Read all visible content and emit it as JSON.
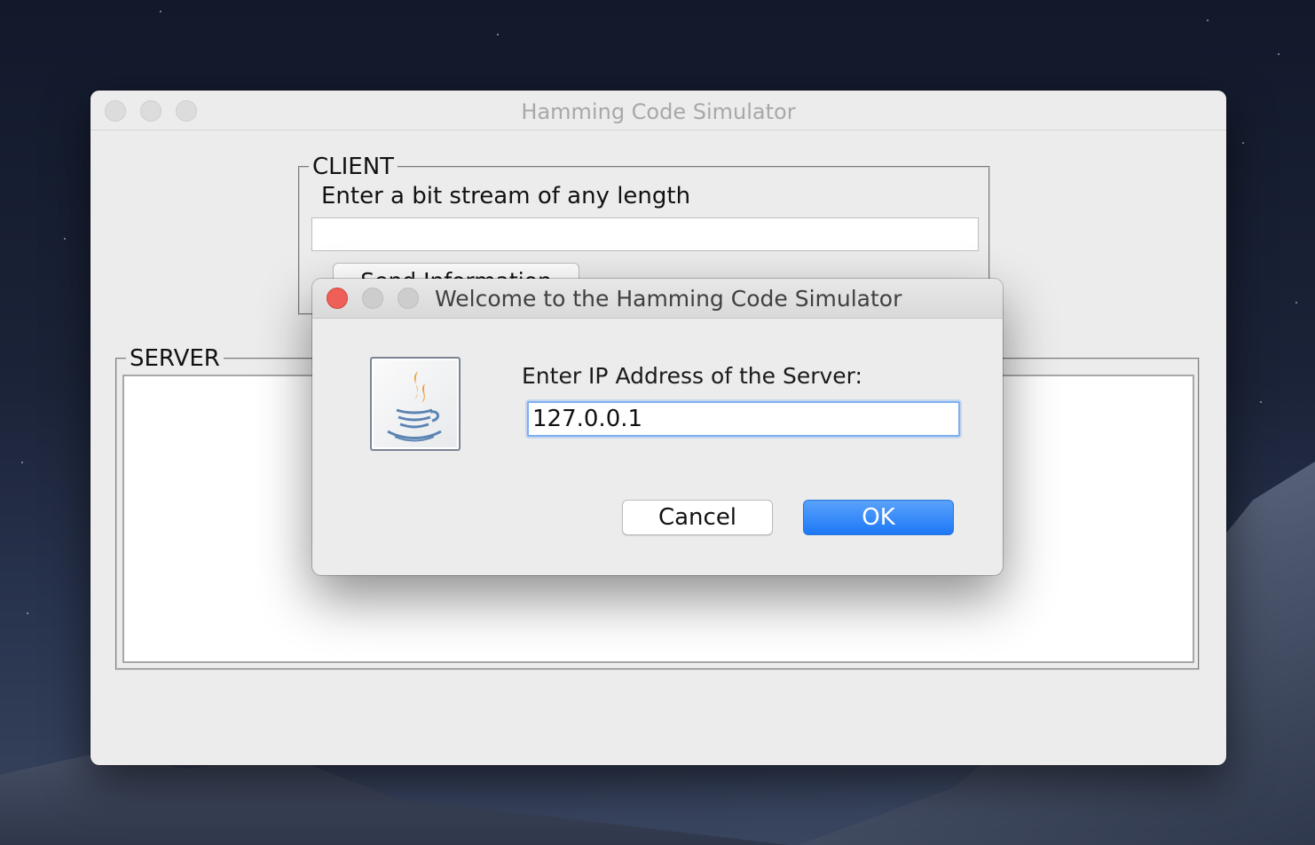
{
  "main_window": {
    "title": "Hamming Code Simulator",
    "client": {
      "legend": "CLIENT",
      "prompt": "Enter a bit stream of any length",
      "bit_stream_value": "",
      "send_button": "Send Information"
    },
    "server": {
      "legend": "SERVER",
      "log_text": ""
    }
  },
  "dialog": {
    "title": "Welcome to the Hamming Code Simulator",
    "prompt": "Enter IP Address of the Server:",
    "ip_value": "127.0.0.1",
    "cancel_label": "Cancel",
    "ok_label": "OK",
    "icon": "java-coffee-cup-icon"
  },
  "colors": {
    "ok_button": "#1d78f6",
    "close_button": "#ee5f57",
    "focus_ring": "#7fb0f3"
  }
}
